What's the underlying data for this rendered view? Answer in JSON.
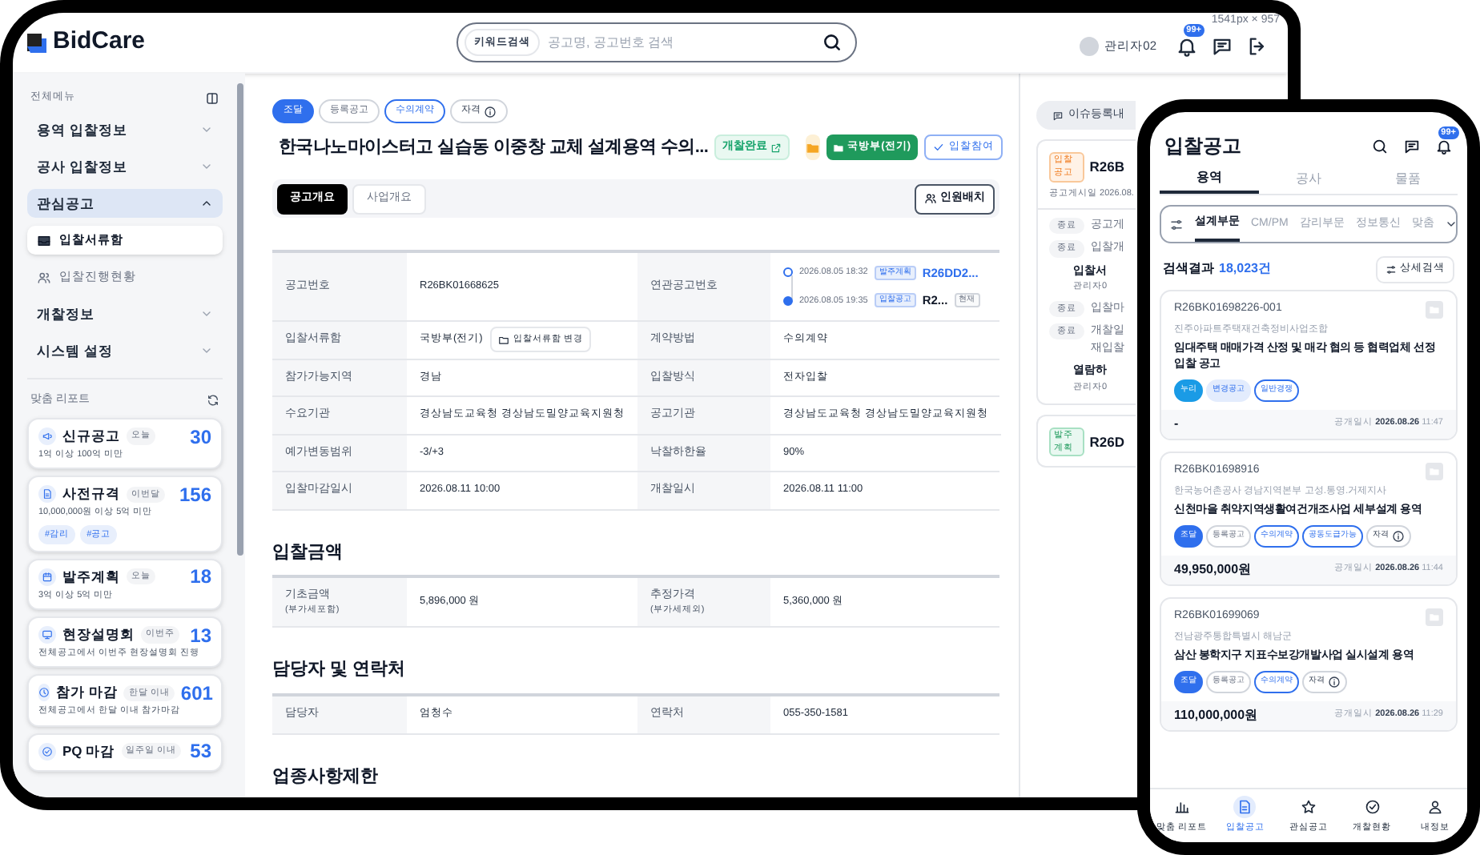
{
  "app": {
    "logo": "BidCare",
    "dimension_label": "1541px × 957"
  },
  "header": {
    "search": {
      "scope": "키워드검색",
      "placeholder": "공고명, 공고번호 검색"
    },
    "user": "관리자02",
    "notification_badge": "99+"
  },
  "sidebar": {
    "title": "전체메뉴",
    "menu": [
      {
        "label": "용역 입찰정보",
        "expanded": false
      },
      {
        "label": "공사 입찰정보",
        "expanded": false
      },
      {
        "label": "관심공고",
        "expanded": true,
        "children": [
          {
            "label": "입찰서류함",
            "selected": true
          },
          {
            "label": "입찰진행현황",
            "selected": false
          }
        ]
      },
      {
        "label": "개찰정보",
        "expanded": false
      },
      {
        "label": "시스템 설정",
        "expanded": false
      }
    ],
    "report_title": "맞춤 리포트",
    "reports": [
      {
        "title": "신규공고",
        "period": "오늘",
        "count": "30",
        "condition": "1억 이상 100억 미만"
      },
      {
        "title": "사전규격",
        "period": "이번달",
        "count": "156",
        "condition": "10,000,000원 이상 5억 미만",
        "tags": [
          "#감리",
          "#공고"
        ]
      },
      {
        "title": "발주계획",
        "period": "오늘",
        "count": "18",
        "condition": "3억 이상 5억 미만"
      },
      {
        "title": "현장설명회",
        "period": "이번주",
        "count": "13",
        "condition": "전체공고에서 이번주 현장설명회 진행"
      },
      {
        "title": "참가 마감",
        "period": "한달 이내",
        "count": "601",
        "condition": "전체공고에서 한달 이내 참가마감"
      },
      {
        "title": "PQ 마감",
        "period": "일주일 이내",
        "count": "53"
      }
    ]
  },
  "notice": {
    "tags": [
      {
        "label": "조달",
        "kind": "filled"
      },
      {
        "label": "등록공고",
        "kind": "gray"
      },
      {
        "label": "수의계약",
        "kind": "outline"
      },
      {
        "label": "자격",
        "kind": "info"
      }
    ],
    "title": "한국나노마이스터고 실습동 이중창 교체 설계용역 수의...",
    "status": "개찰완료",
    "folder_button": "국방부(전기)",
    "participate_button": "입찰참여",
    "tabs": [
      {
        "label": "공고개요",
        "selected": true
      },
      {
        "label": "사업개요",
        "selected": false
      }
    ],
    "staff_button": "인원배치",
    "overview": [
      {
        "label": "공고번호",
        "value": "R26BK01668625",
        "label_2": "연관공고번호",
        "related": [
          {
            "date": "2026.08.05 18:32",
            "type": "발주계획",
            "number": "R26DD2...",
            "current": false
          },
          {
            "date": "2026.08.05 19:35",
            "type": "입찰공고",
            "number": "R2...",
            "current": true,
            "badge": "현재"
          }
        ]
      },
      {
        "label": "입찰서류함",
        "value": "국방부(전기)",
        "action": "입찰서류함 변경",
        "label_2": "계약방법",
        "value_2": "수의계약"
      },
      {
        "label": "참가가능지역",
        "value": "경남",
        "label_2": "입찰방식",
        "value_2": "전자입찰"
      },
      {
        "label": "수요기관",
        "value": "경상남도교육청 경상남도밀양교육지원청",
        "label_2": "공고기관",
        "value_2": "경상남도교육청 경상남도밀양교육지원청"
      },
      {
        "label": "예가변동범위",
        "value": "-3/+3",
        "label_2": "낙찰하한율",
        "value_2": "90%"
      },
      {
        "label": "입찰마감일시",
        "value": "2026.08.11 10:00",
        "label_2": "개찰일시",
        "value_2": "2026.08.11 11:00"
      }
    ],
    "sections": [
      {
        "title": "입찰금액",
        "rows": [
          {
            "label": "기초금액",
            "note": "(부가세포함)",
            "value": "5,896,000 원",
            "label_2": "추정가격",
            "note_2": "(부가세제외)",
            "value_2": "5,360,000 원"
          }
        ]
      },
      {
        "title": "담당자 및 연락처",
        "rows": [
          {
            "label": "담당자",
            "value": "엄청수",
            "label_2": "연락처",
            "value_2": "055-350-1581"
          }
        ]
      },
      {
        "title": "업종사항제한"
      }
    ]
  },
  "side_panel": {
    "issue_button": "이슈등록내",
    "cards": [
      {
        "badge": "입찰공고",
        "kind": "bid",
        "number": "R26B",
        "posted": "공고게시일 2026.08.",
        "events": [
          {
            "status": "종료",
            "text": "공고게"
          },
          {
            "status": "종료",
            "text": "입찰개"
          },
          {
            "bullet": "입찰서",
            "author": "관리자0"
          },
          {
            "status": "종료",
            "text": "입찰마"
          },
          {
            "status": "종료",
            "text": "개찰일",
            "text_2": "재입찰"
          },
          {
            "bullet": "열람하",
            "author": "관리자0"
          }
        ]
      },
      {
        "badge": "발주계획",
        "kind": "plan",
        "number": "R26D"
      }
    ]
  },
  "mobile": {
    "title": "입찰공고",
    "notification_badge": "99+",
    "tabs": [
      {
        "label": "용역",
        "selected": true
      },
      {
        "label": "공사",
        "selected": false
      },
      {
        "label": "물품",
        "selected": false
      }
    ],
    "categories": [
      {
        "label": "설계부문",
        "selected": true
      },
      {
        "label": "CM/PM",
        "selected": false
      },
      {
        "label": "감리부문",
        "selected": false
      },
      {
        "label": "정보통신",
        "selected": false
      },
      {
        "label": "맞춤",
        "selected": false
      }
    ],
    "result_label": "검색결과",
    "result_count": "18,023건",
    "detail_search": "상세검색",
    "cards": [
      {
        "number": "R26BK01698226-001",
        "org": "진주아파트주택재건축정비사업조합",
        "title": "임대주택 매매가격 산정 및 매각 협의 등 협력업체 선정 입찰 공고",
        "tags": [
          {
            "label": "누리",
            "kind": "sky"
          },
          {
            "label": "변경공고",
            "kind": "light"
          },
          {
            "label": "일반경쟁",
            "kind": "outline"
          }
        ],
        "price": "-",
        "date": "공개일시 **2026.08.26** 11:47"
      },
      {
        "number": "R26BK01698916",
        "org": "한국농어촌공사 경남지역본부 고성.통영.거제지사",
        "title": "신천마을 취약지역생활여건개조사업 세부설계 용역",
        "tags": [
          {
            "label": "조달",
            "kind": "filled"
          },
          {
            "label": "등록공고",
            "kind": "gray"
          },
          {
            "label": "수의계약",
            "kind": "outline"
          },
          {
            "label": "공동도급가능",
            "kind": "outline"
          },
          {
            "label": "자격",
            "kind": "info"
          }
        ],
        "price": "49,950,000원",
        "date": "공개일시 **2026.08.26** 11:44"
      },
      {
        "number": "R26BK01699069",
        "org": "전남광주통합특별시 해남군",
        "title": "삼산 봉학지구 지표수보강개발사업 실시설계 용역",
        "tags": [
          {
            "label": "조달",
            "kind": "filled"
          },
          {
            "label": "등록공고",
            "kind": "gray"
          },
          {
            "label": "수의계약",
            "kind": "outline"
          },
          {
            "label": "자격",
            "kind": "info"
          }
        ],
        "price": "110,000,000원",
        "date": "공개일시 **2026.08.26** 11:29"
      }
    ],
    "nav": [
      {
        "label": "맞춤 리포트",
        "selected": false
      },
      {
        "label": "입찰공고",
        "selected": true
      },
      {
        "label": "관심공고",
        "selected": false
      },
      {
        "label": "개찰현황",
        "selected": false
      },
      {
        "label": "내정보",
        "selected": false
      }
    ]
  }
}
